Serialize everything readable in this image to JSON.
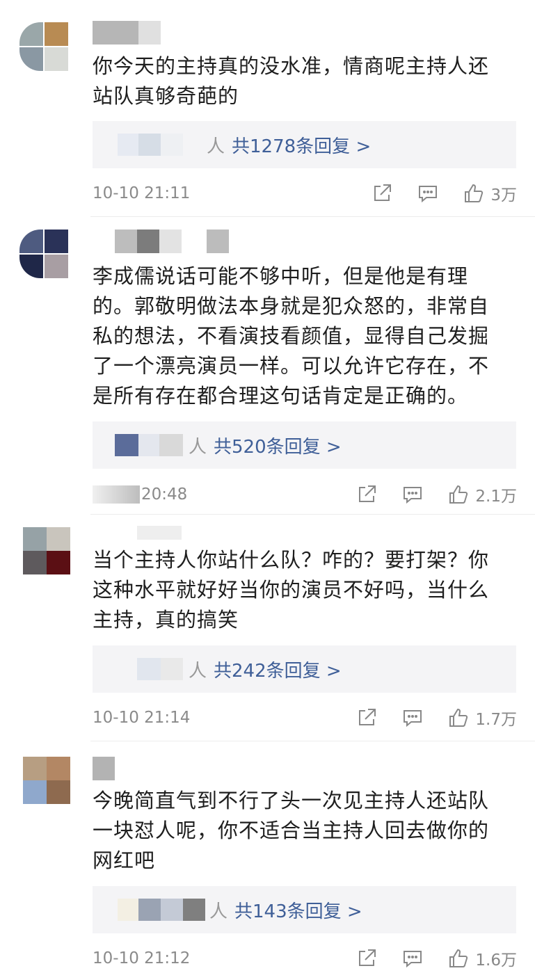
{
  "colors": {
    "background": "#ffffff",
    "reply_box": "#f4f4f6",
    "link": "#3f5f98",
    "meta": "#8a8a8a"
  },
  "comments": [
    {
      "text": "你今天的主持真的没水准，情商呢主持人还\n站队真够奇葩的",
      "reply_suffix": "人",
      "reply_count": "共1278条回复 >",
      "time": "10-10 21:11",
      "like_count": "3万"
    },
    {
      "text": "李成儒说话可能不够中听，但是他是有理\n的。郭敬明做法本身就是犯众怒的，非常自\n私的想法，不看演技看颜值，显得自己发掘\n了一个漂亮演员一样。可以允许它存在，不\n是所有存在都合理这句话肯定是正确的。",
      "reply_suffix": "人",
      "reply_count": "共520条回复 >",
      "time": "20:48",
      "like_count": "2.1万"
    },
    {
      "text": "当个主持人你站什么队？咋的？要打架？你\n这种水平就好好当你的演员不好吗，当什么\n主持，真的搞笑",
      "reply_suffix": "人",
      "reply_count": "共242条回复 >",
      "time": "10-10 21:14",
      "like_count": "1.7万"
    },
    {
      "text": "今晚简直气到不行了头一次见主持人还站队\n一块怼人呢，你不适合当主持人回去做你的\n网红吧",
      "reply_suffix": "人",
      "reply_count": "共143条回复 >",
      "time": "10-10 21:12",
      "like_count": "1.6万"
    }
  ],
  "icons": {
    "share": "share-icon",
    "comment": "comment-icon",
    "like": "thumbs-up-icon"
  }
}
